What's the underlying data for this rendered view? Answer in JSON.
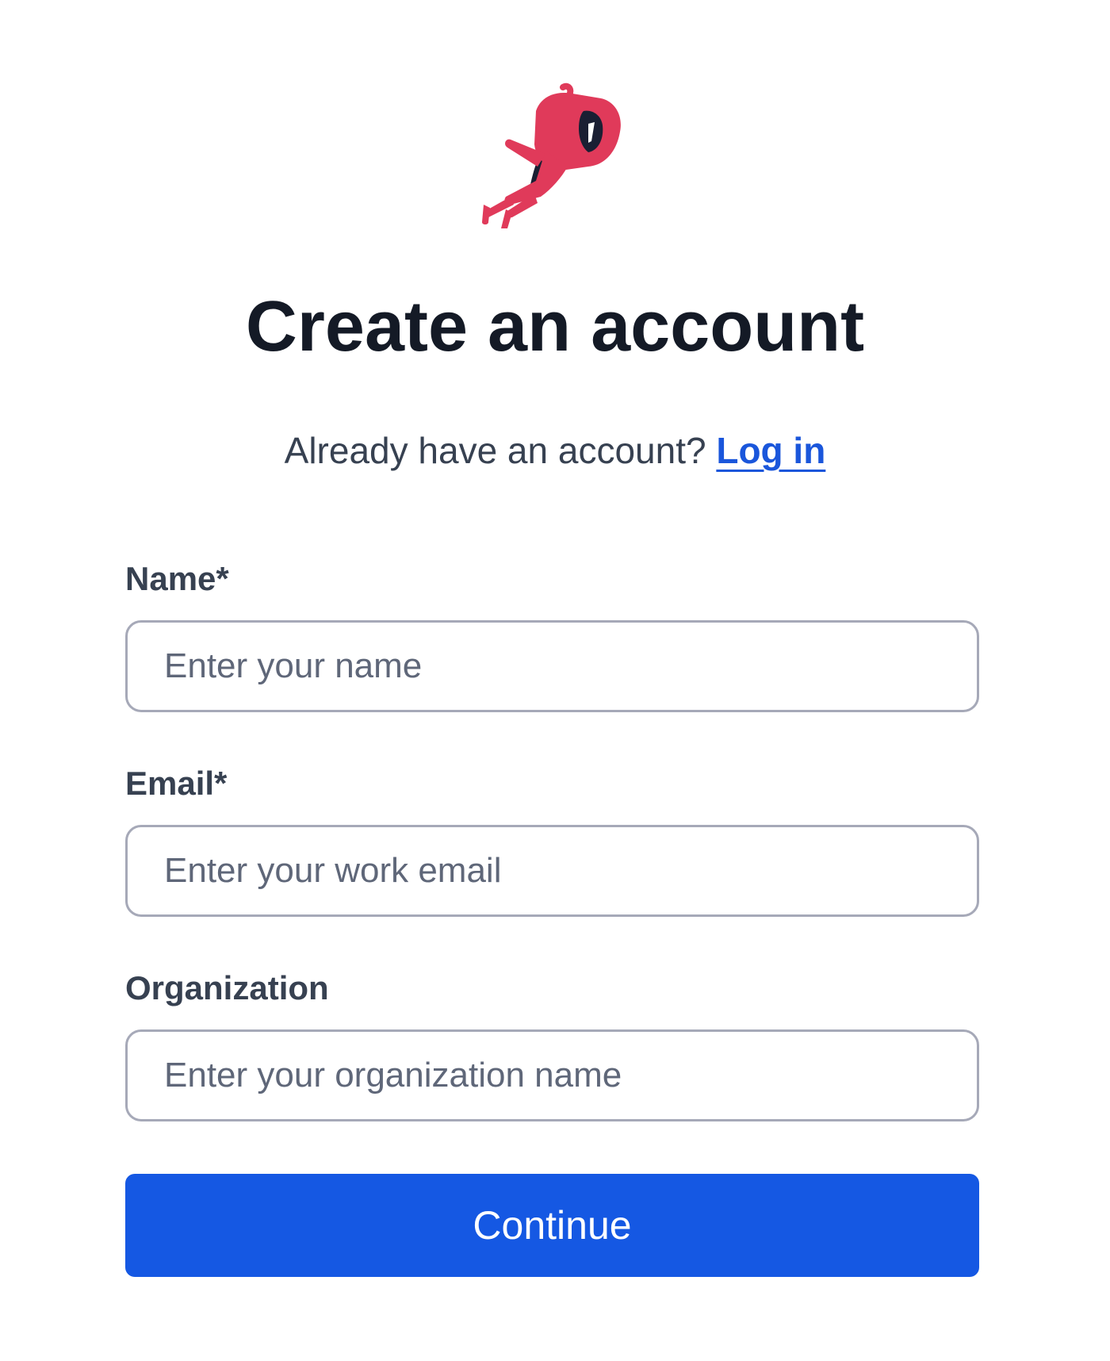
{
  "brand": {
    "logo_icon": "flying-red-ninja-icon",
    "logo_color": "#e03a5a",
    "logo_dark": "#1a1f33"
  },
  "header": {
    "title": "Create an account"
  },
  "subline": {
    "text": "Already have an account?",
    "login_link": "Log in"
  },
  "form": {
    "name": {
      "label": "Name*",
      "placeholder": "Enter your name",
      "value": ""
    },
    "email": {
      "label": "Email*",
      "placeholder": "Enter your work email",
      "value": ""
    },
    "organization": {
      "label": "Organization",
      "placeholder": "Enter your organization name",
      "value": ""
    },
    "continue_label": "Continue"
  },
  "colors": {
    "accent": "#1558e3",
    "link": "#1a56db",
    "title": "#141a26",
    "label": "#374151",
    "input_border": "#a6a9b8"
  }
}
